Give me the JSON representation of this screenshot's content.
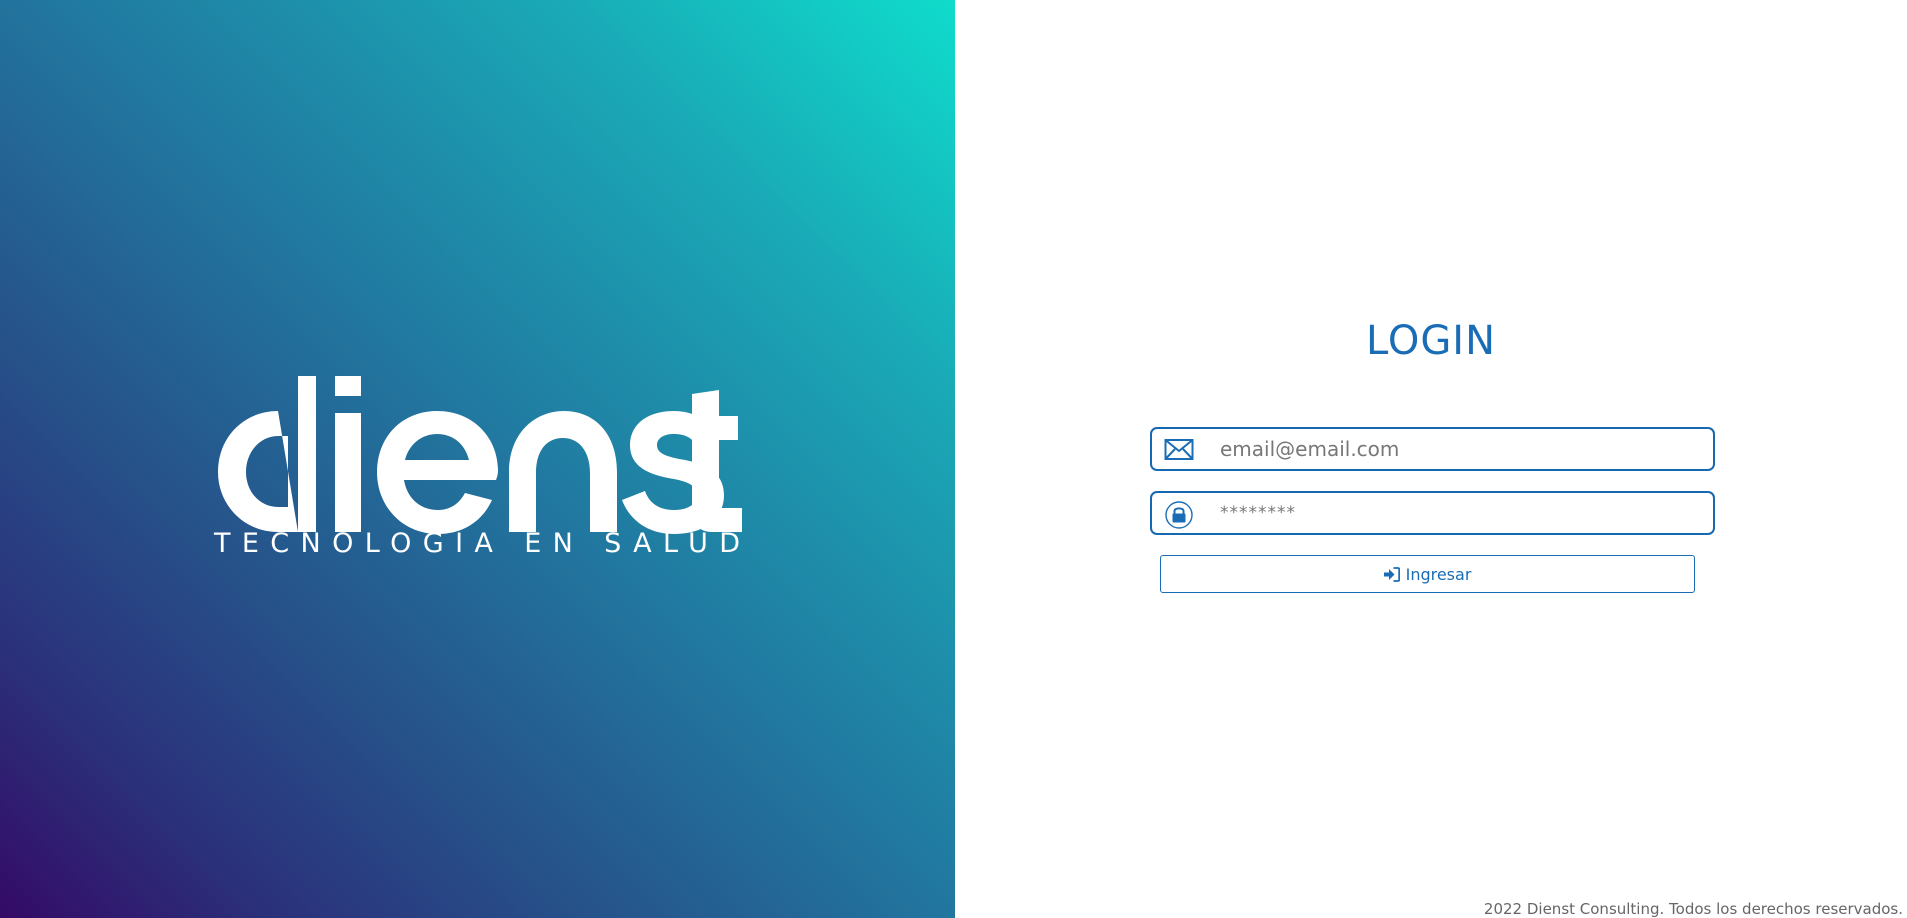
{
  "brand": {
    "name": "dienst",
    "tagline": "TECNOLOGÍA EN SALUD"
  },
  "login": {
    "title": "LOGIN",
    "email": {
      "placeholder": "email@email.com",
      "value": "",
      "icon": "envelope-icon"
    },
    "password": {
      "placeholder": "********",
      "value": "",
      "icon": "lock-icon"
    },
    "submit": {
      "label": "Ingresar",
      "icon": "sign-in-icon"
    }
  },
  "footer": {
    "text": "2022 Dienst Consulting. Todos los derechos reservados."
  },
  "colors": {
    "accent": "#1a6db5",
    "gradient_start": "#0fdccb",
    "gradient_end": "#340a66"
  }
}
